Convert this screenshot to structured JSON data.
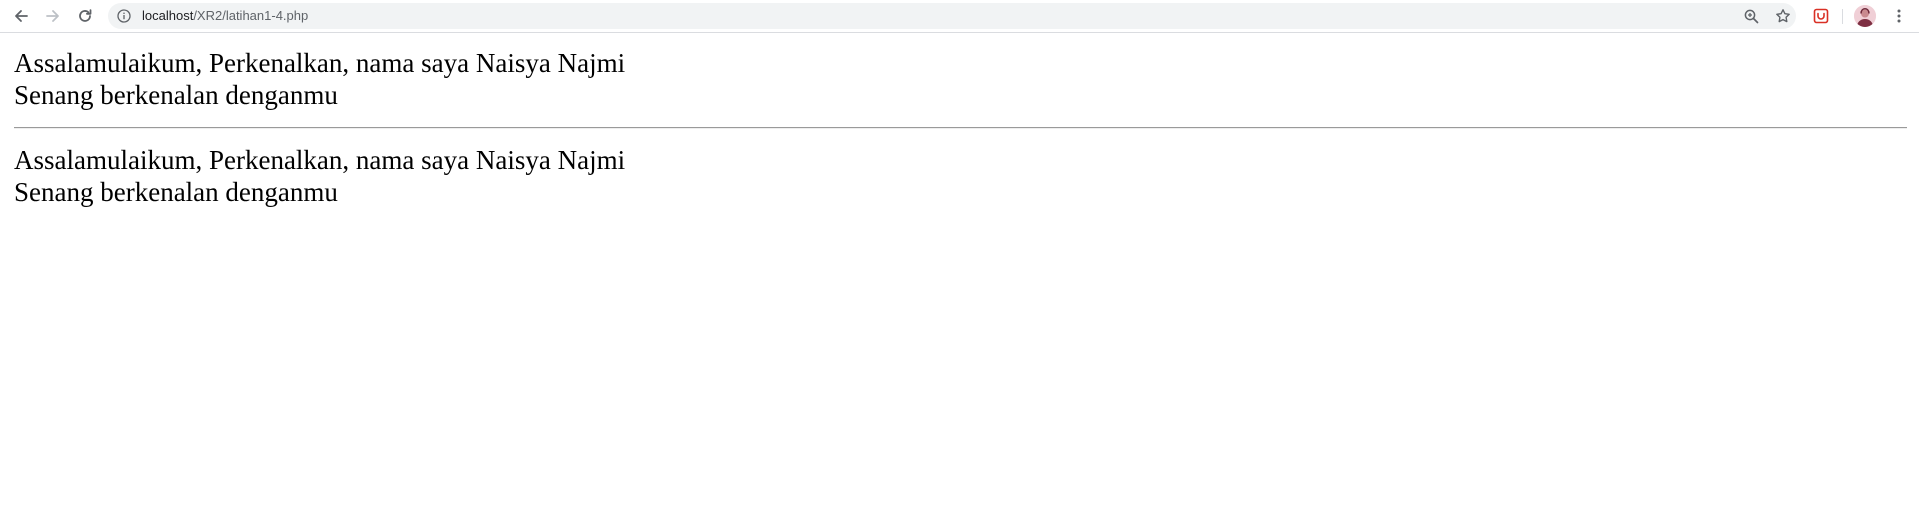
{
  "browser": {
    "url_host": "localhost",
    "url_path": "/XR2/latihan1-4.php",
    "icons": {
      "back": "arrow-left-icon",
      "forward": "arrow-right-icon",
      "reload": "reload-icon",
      "site_info": "info-circle-icon",
      "zoom": "zoom-in-icon",
      "bookmark": "star-icon",
      "extension": "extension-icon",
      "profile": "avatar",
      "menu": "kebab-menu-icon"
    },
    "colors": {
      "omnibox_bg": "#f1f3f4",
      "extension_red": "#d93025"
    }
  },
  "page": {
    "blocks": [
      {
        "line1": "Assalamulaikum, Perkenalkan, nama saya Naisya Najmi",
        "line2": "Senang berkenalan denganmu"
      },
      {
        "line1": "Assalamulaikum, Perkenalkan, nama saya Naisya Najmi",
        "line2": "Senang berkenalan denganmu"
      }
    ]
  }
}
